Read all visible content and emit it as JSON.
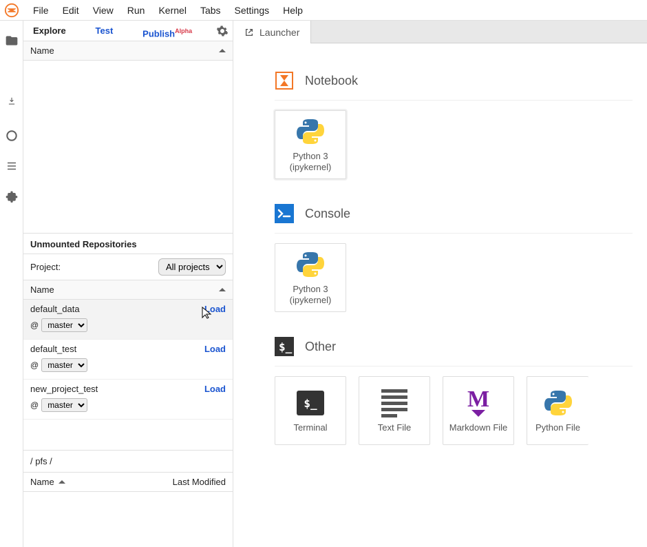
{
  "menubar": {
    "items": [
      "File",
      "Edit",
      "View",
      "Run",
      "Kernel",
      "Tabs",
      "Settings",
      "Help"
    ]
  },
  "sidepanel": {
    "tabs": {
      "explore": "Explore",
      "test": "Test",
      "publish": "Publish",
      "publish_sup": "Alpha"
    },
    "name_header": "Name",
    "unmounted": {
      "title": "Unmounted Repositories",
      "project_label": "Project:",
      "project_value": "All projects",
      "name_header": "Name",
      "load_label": "Load",
      "repos": [
        {
          "name": "default_data",
          "branch": "master",
          "highlight": true
        },
        {
          "name": "default_test",
          "branch": "master",
          "highlight": false
        },
        {
          "name": "new_project_test",
          "branch": "master",
          "highlight": false
        }
      ]
    },
    "filebrowser": {
      "path": "/ pfs /",
      "col_name": "Name",
      "col_modified": "Last Modified"
    }
  },
  "launcher": {
    "tab_label": "Launcher",
    "sections": {
      "notebook": {
        "title": "Notebook",
        "tile_label": "Python 3 (ipykernel)"
      },
      "console": {
        "title": "Console",
        "tile_label": "Python 3 (ipykernel)"
      },
      "other": {
        "title": "Other",
        "tiles": [
          {
            "label": "Terminal",
            "kind": "terminal"
          },
          {
            "label": "Text File",
            "kind": "textfile"
          },
          {
            "label": "Markdown File",
            "kind": "markdown"
          },
          {
            "label": "Python File",
            "kind": "python"
          }
        ]
      }
    }
  }
}
